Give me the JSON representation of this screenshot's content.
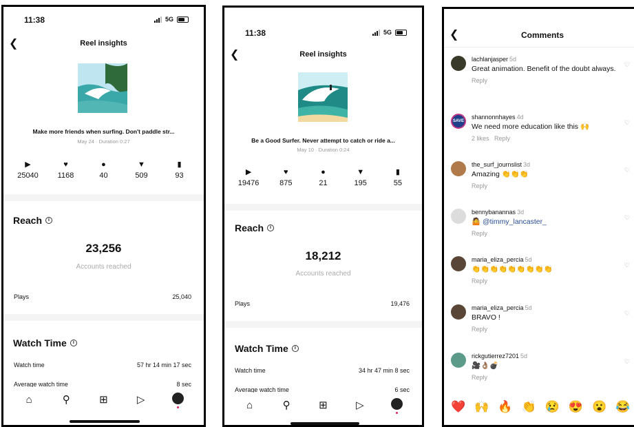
{
  "screens": [
    {
      "time": "11:38",
      "network": "5G",
      "battery": "30",
      "title": "Reel insights",
      "caption": "Make more friends when surfing. Don't paddle str...",
      "meta": "May 24 · Duration 0:27",
      "stats": {
        "plays": "25040",
        "likes": "1168",
        "comments": "40",
        "shares": "509",
        "saves": "93"
      },
      "reach_title": "Reach",
      "reach_value": "23,256",
      "reach_label": "Accounts reached",
      "plays_label": "Plays",
      "plays_value": "25,040",
      "watch_title": "Watch Time",
      "watch_label": "Watch time",
      "watch_value": "57 hr 14 min 17 sec",
      "avg_label": "Average watch time",
      "avg_value": "8 sec"
    },
    {
      "time": "11:38",
      "network": "5G",
      "battery": "30",
      "title": "Reel insights",
      "caption": "Be a Good Surfer. Never attempt to catch or ride a...",
      "meta": "May 10 · Duration 0:24",
      "stats": {
        "plays": "19476",
        "likes": "875",
        "comments": "21",
        "shares": "195",
        "saves": "55"
      },
      "reach_title": "Reach",
      "reach_value": "18,212",
      "reach_label": "Accounts reached",
      "plays_label": "Plays",
      "plays_value": "19,476",
      "watch_title": "Watch Time",
      "watch_label": "Watch time",
      "watch_value": "34 hr 47 min 8 sec",
      "avg_label": "Average watch time",
      "avg_value": "6 sec"
    }
  ],
  "comments_screen": {
    "title": "Comments",
    "comments": [
      {
        "user": "lachlanjasper",
        "ago": "5d",
        "text": "Great animation. Benefit of the doubt always.",
        "meta": "Reply",
        "avatar_color": "#3a3a2a"
      },
      {
        "user": "shannonnhayes",
        "ago": "4d",
        "text": "We need more education like this 🙌",
        "meta": "2 likes   Reply",
        "avatar_color": "#1f3f8a",
        "avatar_text": "SAVE"
      },
      {
        "user": "the_surf_journslist",
        "ago": "3d",
        "text": "Amazing 👏👏👏",
        "meta": "Reply",
        "avatar_color": "#b07a4a"
      },
      {
        "user": "bennybanannas",
        "ago": "3d",
        "text_emoji": "🤷",
        "text_mention": "@timmy_lancaster_",
        "meta": "Reply",
        "avatar_color": "#dcdcdc"
      },
      {
        "user": "maria_eliza_percia",
        "ago": "5d",
        "text": "👏👏👏👏👏👏👏👏👏",
        "meta": "Reply",
        "avatar_color": "#5a4636"
      },
      {
        "user": "maria_eliza_percia",
        "ago": "5d",
        "text": "BRAVO !",
        "meta": "Reply",
        "avatar_color": "#5a4636"
      },
      {
        "user": "rickgutierrez7201",
        "ago": "5d",
        "text": "🎥👌🏽💣",
        "meta": "Reply",
        "avatar_color": "#5c9a8a"
      }
    ],
    "reactions": [
      "❤️",
      "🙌",
      "🔥",
      "👏",
      "😢",
      "😍",
      "😮",
      "😂"
    ]
  }
}
